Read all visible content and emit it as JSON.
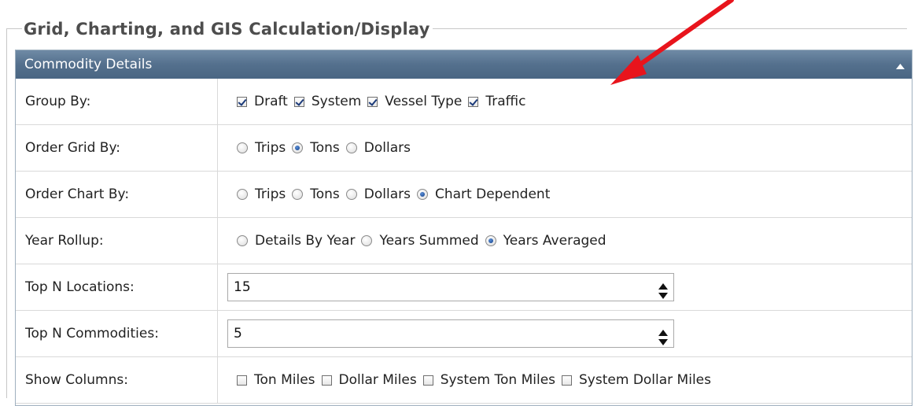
{
  "fieldset": {
    "legend": "Grid, Charting, and GIS Calculation/Display"
  },
  "panel": {
    "title": "Commodity Details",
    "collapse_icon": "triangle-up-icon"
  },
  "rows": {
    "group_by": {
      "label": "Group By:",
      "options": [
        {
          "label": "Draft",
          "checked": true
        },
        {
          "label": "System",
          "checked": true
        },
        {
          "label": "Vessel Type",
          "checked": true
        },
        {
          "label": "Traffic",
          "checked": true
        }
      ]
    },
    "order_grid_by": {
      "label": "Order Grid By:",
      "options": [
        {
          "label": "Trips",
          "selected": false
        },
        {
          "label": "Tons",
          "selected": true
        },
        {
          "label": "Dollars",
          "selected": false
        }
      ]
    },
    "order_chart_by": {
      "label": "Order Chart By:",
      "options": [
        {
          "label": "Trips",
          "selected": false
        },
        {
          "label": "Tons",
          "selected": false
        },
        {
          "label": "Dollars",
          "selected": false
        },
        {
          "label": "Chart Dependent",
          "selected": true
        }
      ]
    },
    "year_rollup": {
      "label": "Year Rollup:",
      "options": [
        {
          "label": "Details By Year",
          "selected": false
        },
        {
          "label": "Years Summed",
          "selected": false
        },
        {
          "label": "Years Averaged",
          "selected": true
        }
      ]
    },
    "top_n_locations": {
      "label": "Top N Locations:",
      "value": "15"
    },
    "top_n_commodities": {
      "label": "Top N Commodities:",
      "value": "5"
    },
    "show_columns": {
      "label": "Show Columns:",
      "options": [
        {
          "label": "Ton Miles",
          "checked": false
        },
        {
          "label": "Dollar Miles",
          "checked": false
        },
        {
          "label": "System Ton Miles",
          "checked": false
        },
        {
          "label": "System Dollar Miles",
          "checked": false
        }
      ]
    }
  },
  "annotation": {
    "color": "#e8141c",
    "icon": "red-arrow-annotation"
  }
}
